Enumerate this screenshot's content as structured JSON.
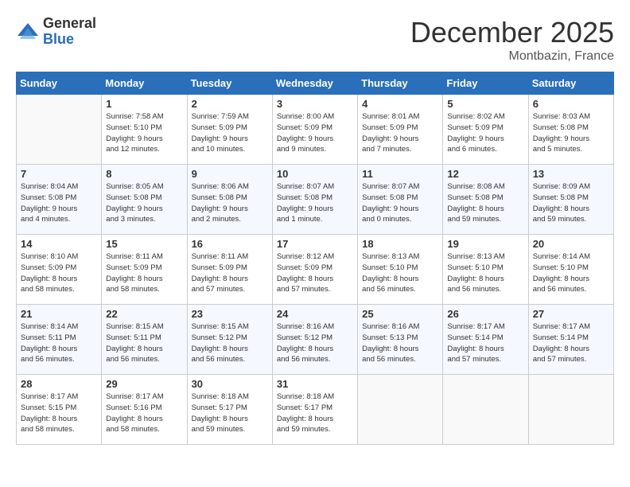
{
  "logo": {
    "general": "General",
    "blue": "Blue"
  },
  "title": "December 2025",
  "subtitle": "Montbazin, France",
  "days_of_week": [
    "Sunday",
    "Monday",
    "Tuesday",
    "Wednesday",
    "Thursday",
    "Friday",
    "Saturday"
  ],
  "weeks": [
    [
      {
        "day": "",
        "info": ""
      },
      {
        "day": "1",
        "info": "Sunrise: 7:58 AM\nSunset: 5:10 PM\nDaylight: 9 hours\nand 12 minutes."
      },
      {
        "day": "2",
        "info": "Sunrise: 7:59 AM\nSunset: 5:09 PM\nDaylight: 9 hours\nand 10 minutes."
      },
      {
        "day": "3",
        "info": "Sunrise: 8:00 AM\nSunset: 5:09 PM\nDaylight: 9 hours\nand 9 minutes."
      },
      {
        "day": "4",
        "info": "Sunrise: 8:01 AM\nSunset: 5:09 PM\nDaylight: 9 hours\nand 7 minutes."
      },
      {
        "day": "5",
        "info": "Sunrise: 8:02 AM\nSunset: 5:09 PM\nDaylight: 9 hours\nand 6 minutes."
      },
      {
        "day": "6",
        "info": "Sunrise: 8:03 AM\nSunset: 5:08 PM\nDaylight: 9 hours\nand 5 minutes."
      }
    ],
    [
      {
        "day": "7",
        "info": "Sunrise: 8:04 AM\nSunset: 5:08 PM\nDaylight: 9 hours\nand 4 minutes."
      },
      {
        "day": "8",
        "info": "Sunrise: 8:05 AM\nSunset: 5:08 PM\nDaylight: 9 hours\nand 3 minutes."
      },
      {
        "day": "9",
        "info": "Sunrise: 8:06 AM\nSunset: 5:08 PM\nDaylight: 9 hours\nand 2 minutes."
      },
      {
        "day": "10",
        "info": "Sunrise: 8:07 AM\nSunset: 5:08 PM\nDaylight: 9 hours\nand 1 minute."
      },
      {
        "day": "11",
        "info": "Sunrise: 8:07 AM\nSunset: 5:08 PM\nDaylight: 9 hours\nand 0 minutes."
      },
      {
        "day": "12",
        "info": "Sunrise: 8:08 AM\nSunset: 5:08 PM\nDaylight: 8 hours\nand 59 minutes."
      },
      {
        "day": "13",
        "info": "Sunrise: 8:09 AM\nSunset: 5:08 PM\nDaylight: 8 hours\nand 59 minutes."
      }
    ],
    [
      {
        "day": "14",
        "info": "Sunrise: 8:10 AM\nSunset: 5:09 PM\nDaylight: 8 hours\nand 58 minutes."
      },
      {
        "day": "15",
        "info": "Sunrise: 8:11 AM\nSunset: 5:09 PM\nDaylight: 8 hours\nand 58 minutes."
      },
      {
        "day": "16",
        "info": "Sunrise: 8:11 AM\nSunset: 5:09 PM\nDaylight: 8 hours\nand 57 minutes."
      },
      {
        "day": "17",
        "info": "Sunrise: 8:12 AM\nSunset: 5:09 PM\nDaylight: 8 hours\nand 57 minutes."
      },
      {
        "day": "18",
        "info": "Sunrise: 8:13 AM\nSunset: 5:10 PM\nDaylight: 8 hours\nand 56 minutes."
      },
      {
        "day": "19",
        "info": "Sunrise: 8:13 AM\nSunset: 5:10 PM\nDaylight: 8 hours\nand 56 minutes."
      },
      {
        "day": "20",
        "info": "Sunrise: 8:14 AM\nSunset: 5:10 PM\nDaylight: 8 hours\nand 56 minutes."
      }
    ],
    [
      {
        "day": "21",
        "info": "Sunrise: 8:14 AM\nSunset: 5:11 PM\nDaylight: 8 hours\nand 56 minutes."
      },
      {
        "day": "22",
        "info": "Sunrise: 8:15 AM\nSunset: 5:11 PM\nDaylight: 8 hours\nand 56 minutes."
      },
      {
        "day": "23",
        "info": "Sunrise: 8:15 AM\nSunset: 5:12 PM\nDaylight: 8 hours\nand 56 minutes."
      },
      {
        "day": "24",
        "info": "Sunrise: 8:16 AM\nSunset: 5:12 PM\nDaylight: 8 hours\nand 56 minutes."
      },
      {
        "day": "25",
        "info": "Sunrise: 8:16 AM\nSunset: 5:13 PM\nDaylight: 8 hours\nand 56 minutes."
      },
      {
        "day": "26",
        "info": "Sunrise: 8:17 AM\nSunset: 5:14 PM\nDaylight: 8 hours\nand 57 minutes."
      },
      {
        "day": "27",
        "info": "Sunrise: 8:17 AM\nSunset: 5:14 PM\nDaylight: 8 hours\nand 57 minutes."
      }
    ],
    [
      {
        "day": "28",
        "info": "Sunrise: 8:17 AM\nSunset: 5:15 PM\nDaylight: 8 hours\nand 58 minutes."
      },
      {
        "day": "29",
        "info": "Sunrise: 8:17 AM\nSunset: 5:16 PM\nDaylight: 8 hours\nand 58 minutes."
      },
      {
        "day": "30",
        "info": "Sunrise: 8:18 AM\nSunset: 5:17 PM\nDaylight: 8 hours\nand 59 minutes."
      },
      {
        "day": "31",
        "info": "Sunrise: 8:18 AM\nSunset: 5:17 PM\nDaylight: 8 hours\nand 59 minutes."
      },
      {
        "day": "",
        "info": ""
      },
      {
        "day": "",
        "info": ""
      },
      {
        "day": "",
        "info": ""
      }
    ]
  ]
}
